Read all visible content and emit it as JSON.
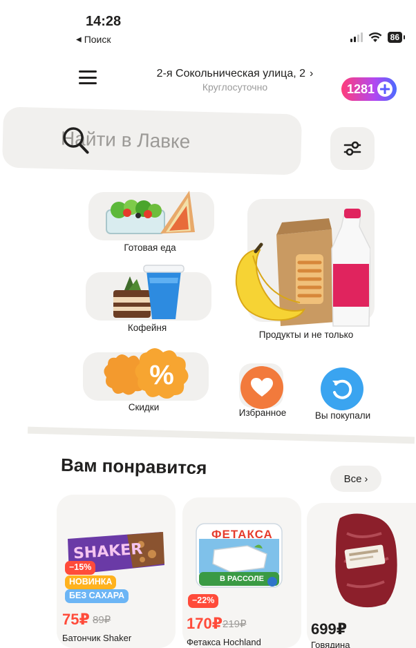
{
  "status_bar": {
    "time": "14:28",
    "back_label": "Поиск",
    "battery": "86"
  },
  "header": {
    "address": "2-я Сокольническая улица, 2",
    "hours": "Круглосуточно",
    "cashback": "1281"
  },
  "search": {
    "placeholder": "Найти в Лавке"
  },
  "categories": [
    {
      "label": "Готовая еда"
    },
    {
      "label": "Кофейня"
    },
    {
      "label": "Продукты и не только"
    },
    {
      "label": "Скидки"
    },
    {
      "label": "Избранное"
    },
    {
      "label": "Вы покупали"
    }
  ],
  "recommendations": {
    "title": "Вам понравится",
    "all_label": "Все",
    "products": [
      {
        "brand": "SHAKER",
        "discount": "−15%",
        "tags": [
          "НОВИНКА",
          "БЕЗ САХАРА"
        ],
        "price": "75₽",
        "old_price": "89₽",
        "name": "Батончик Shaker"
      },
      {
        "brand": "ФЕТАКСА",
        "pack_label": "В РАССОЛЕ",
        "discount": "−22%",
        "price": "170₽",
        "old_price": "219₽",
        "name": "Фетакса Hochland"
      },
      {
        "price": "699₽",
        "name": "Говядина"
      }
    ]
  },
  "colors": {
    "accent_red": "#ff4b3a",
    "badge_yellow": "#ffb21e",
    "badge_blue": "#6cb5f5",
    "cashback_start": "#ff3d7a",
    "cashback_end": "#4b6bff"
  }
}
